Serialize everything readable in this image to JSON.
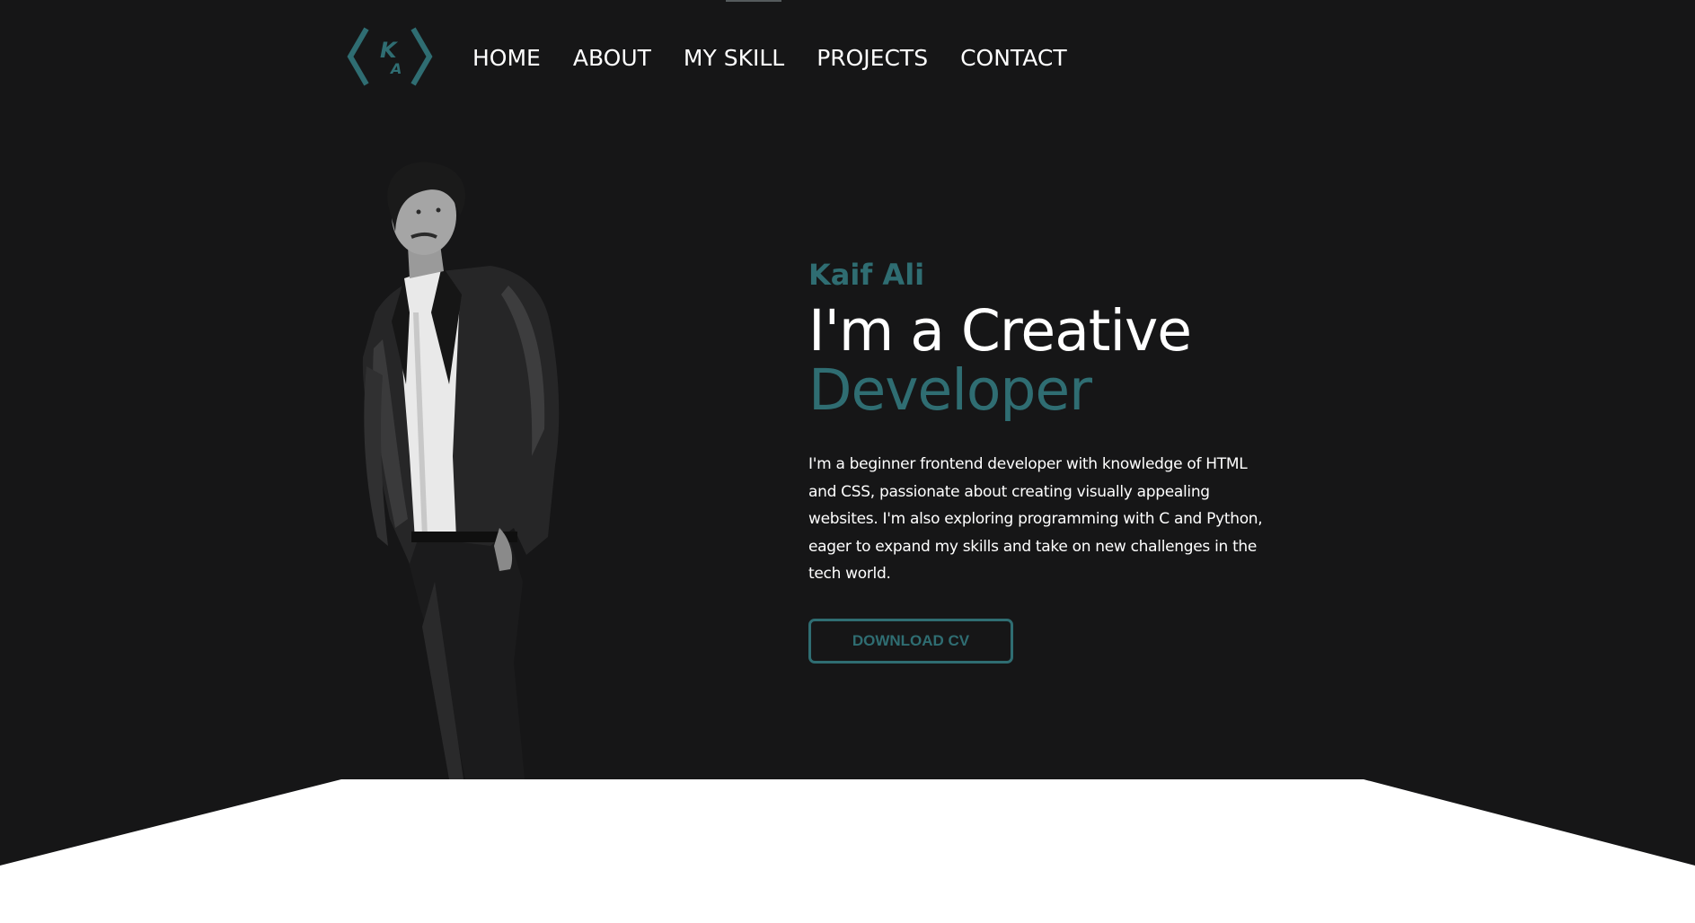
{
  "logo": {
    "letters_top": "K",
    "letters_bottom": "A"
  },
  "nav": {
    "items": [
      {
        "label": "HOME"
      },
      {
        "label": "ABOUT"
      },
      {
        "label": "MY SKILL"
      },
      {
        "label": "PROJECTS"
      },
      {
        "label": "CONTACT"
      }
    ]
  },
  "hero": {
    "name": "Kaif Ali",
    "headline_line1": "I'm a Creative",
    "headline_line2": "Developer",
    "description": "I'm a beginner frontend developer with knowledge of HTML and CSS, passionate about creating visually appealing websites. I'm also exploring programming with C and Python, eager to expand my skills and take on new challenges in the tech world.",
    "cta_label": "DOWNLOAD CV"
  },
  "colors": {
    "background": "#161617",
    "accent": "#2f6d72",
    "text": "#ffffff"
  }
}
